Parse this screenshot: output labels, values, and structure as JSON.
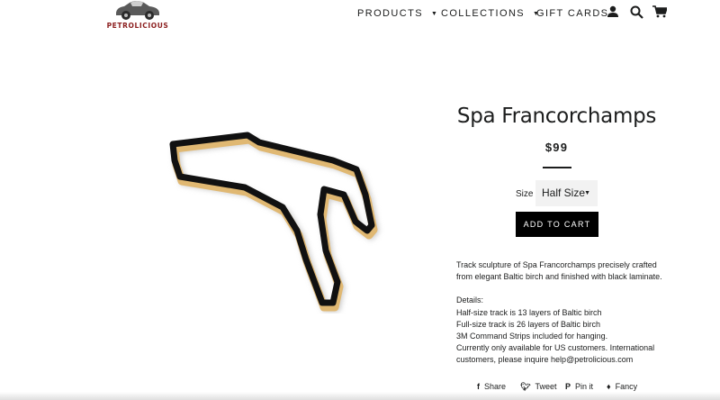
{
  "header": {
    "logo_text": "PETROLICIOUS",
    "nav": [
      {
        "label": "PRODUCTS",
        "has_dropdown": true
      },
      {
        "label": "COLLECTIONS",
        "has_dropdown": true
      },
      {
        "label": "GIFT CARDS",
        "has_dropdown": false
      }
    ],
    "icons": [
      "account-icon",
      "search-icon",
      "cart-icon"
    ]
  },
  "product": {
    "title": "Spa Francorchamps",
    "price": "$99",
    "size_label": "Size",
    "size_selected": "Half Size",
    "add_to_cart_label": "ADD TO CART",
    "description": "Track sculpture of Spa Francorchamps precisely crafted from elegant Baltic birch and finished with black laminate.",
    "details_heading": "Details:",
    "details": [
      "Half-size track is 13 layers of Baltic birch",
      "Full-size track is 26 layers of Baltic birch",
      "3M Command Strips included for hanging.",
      "Currently only available for US customers. International customers, please inquire help@petrolicious.com"
    ]
  },
  "share": [
    {
      "label": "Share",
      "icon": "facebook-icon"
    },
    {
      "label": "Tweet",
      "icon": "twitter-icon"
    },
    {
      "label": "Pin it",
      "icon": "pinterest-icon"
    },
    {
      "label": "Fancy",
      "icon": "fancy-icon"
    }
  ],
  "colors": {
    "text": "#1c1d1d",
    "logo_accent": "#8b1d1d",
    "button_bg": "#000000",
    "select_bg": "#f2f2f2",
    "wood": "#e0b872"
  }
}
